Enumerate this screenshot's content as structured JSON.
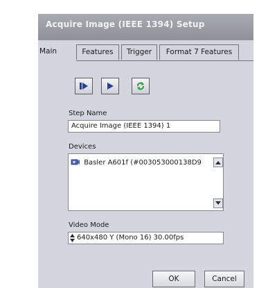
{
  "dialog": {
    "title": "Acquire Image (IEEE 1394) Setup",
    "tabs": [
      {
        "label": "Main",
        "active": true
      },
      {
        "label": "Features",
        "active": false
      },
      {
        "label": "Trigger",
        "active": false
      },
      {
        "label": "Format 7 Features",
        "active": false
      }
    ]
  },
  "toolbar": {
    "icons": [
      "run-step-icon",
      "play-icon",
      "refresh-icon"
    ],
    "colors": {
      "arrow": "#1f3fa8",
      "refresh": "#2e9e3a"
    }
  },
  "step_name": {
    "label": "Step Name",
    "value": "Acquire Image (IEEE 1394) 1"
  },
  "devices": {
    "label": "Devices",
    "items": [
      {
        "label": "Basler A601f (#003053000138D9",
        "icon": "camera-icon"
      }
    ]
  },
  "video_mode": {
    "label": "Video Mode",
    "value": "640x480 Y (Mono 16) 30.00fps"
  },
  "buttons": {
    "ok": "OK",
    "cancel": "Cancel"
  }
}
